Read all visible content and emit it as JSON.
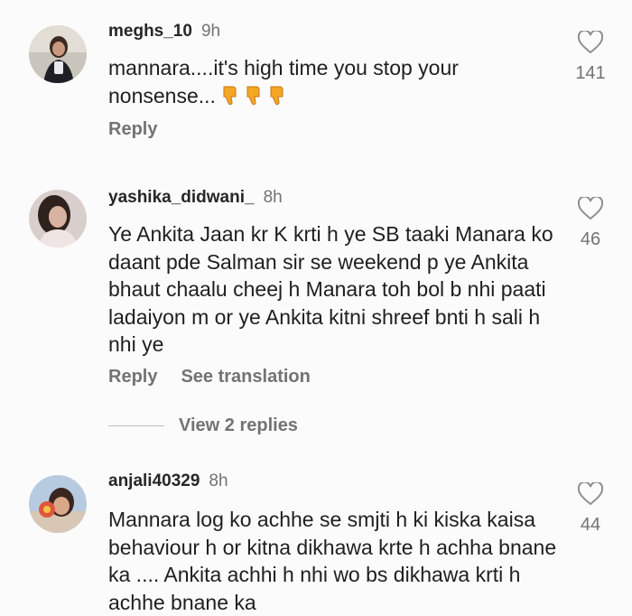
{
  "comments": [
    {
      "username": "meghs_10",
      "time": "9h",
      "text": "mannara....it's high time you stop your nonsense...",
      "emoji": "thumbs-down x3",
      "actions": [
        "Reply"
      ],
      "likes": "141"
    },
    {
      "username": "yashika_didwani_",
      "time": "8h",
      "text": "Ye Ankita Jaan kr K krti h ye SB taaki Manara ko daant pde Salman sir se weekend p ye Ankita bhaut chaalu cheej h Manara toh bol b nhi paati ladaiyon m or ye Ankita kitni shreef bnti h sali h nhi ye",
      "actions": [
        "Reply",
        "See translation"
      ],
      "likes": "46",
      "view_replies": "View 2 replies"
    },
    {
      "username": "anjali40329",
      "time": "8h",
      "text": "Mannara log ko achhe se smjti h ki kiska kaisa behaviour h or kitna dikhawa krte h achha bnane ka .... Ankita achhi h nhi wo bs dikhawa krti h achhe bnane ka",
      "likes": "44"
    }
  ],
  "icons": {
    "like": "heart-outline-icon",
    "emoji": "thumbs-down-emoji"
  },
  "colors": {
    "background": "#fbfbfb",
    "username": "#262626",
    "secondary": "#737373",
    "emoji": "#f5a623"
  }
}
